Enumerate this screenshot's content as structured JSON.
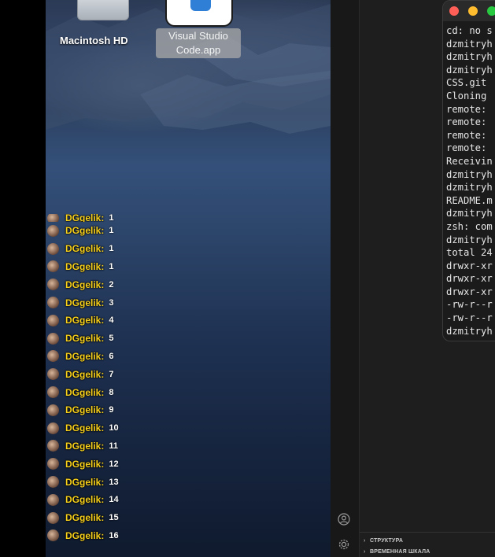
{
  "desktop": {
    "icons": [
      {
        "label": "Macintosh HD",
        "icon": "hard-drive-icon"
      },
      {
        "label": "Visual Studio Code.app",
        "label_line1": "Visual Studio",
        "label_line2": "Code.app",
        "icon": "vscode-app-icon"
      }
    ]
  },
  "chat": {
    "top_partial": {
      "user": "DGgelik:",
      "message": "1"
    },
    "rows": [
      {
        "user": "DGgelik:",
        "message": "1"
      },
      {
        "user": "DGgelik:",
        "message": "1"
      },
      {
        "user": "DGgelik:",
        "message": "1"
      },
      {
        "user": "DGgelik:",
        "message": "2"
      },
      {
        "user": "DGgelik:",
        "message": "3"
      },
      {
        "user": "DGgelik:",
        "message": "4"
      },
      {
        "user": "DGgelik:",
        "message": "5"
      },
      {
        "user": "DGgelik:",
        "message": "6"
      },
      {
        "user": "DGgelik:",
        "message": "7"
      },
      {
        "user": "DGgelik:",
        "message": "8"
      },
      {
        "user": "DGgelik:",
        "message": "9"
      },
      {
        "user": "DGgelik:",
        "message": "10"
      },
      {
        "user": "DGgelik:",
        "message": "11"
      },
      {
        "user": "DGgelik:",
        "message": "12"
      },
      {
        "user": "DGgelik:",
        "message": "13"
      },
      {
        "user": "DGgelik:",
        "message": "14"
      },
      {
        "user": "DGgelik:",
        "message": "15"
      },
      {
        "user": "DGgelik:",
        "message": "16"
      }
    ]
  },
  "vscode": {
    "activity_icons": [
      "account-icon",
      "settings-gear-icon"
    ],
    "sections": [
      {
        "label": "СТРУКТУРА"
      },
      {
        "label": "ВРЕМЕННАЯ ШКАЛА"
      }
    ]
  },
  "terminal": {
    "window_buttons": [
      "close",
      "minimize",
      "zoom"
    ],
    "lines": [
      "cd: no s",
      "dzmitryh",
      "dzmitryh",
      "dzmitryh",
      "CSS.git",
      "Cloning",
      "remote:",
      "remote:",
      "remote:",
      "remote:",
      "Receivin",
      "dzmitryh",
      "dzmitryh",
      "README.m",
      "dzmitryh",
      "zsh: com",
      "dzmitryh",
      "total 24",
      "drwxr-xr",
      "drwxr-xr",
      "drwxr-xr",
      "-rw-r--r",
      "-rw-r--r",
      "dzmitryh"
    ]
  },
  "colors": {
    "chat_user": "#f6cf1a",
    "close": "#ff5f57",
    "minimize": "#febc2e",
    "zoom": "#28c840"
  }
}
